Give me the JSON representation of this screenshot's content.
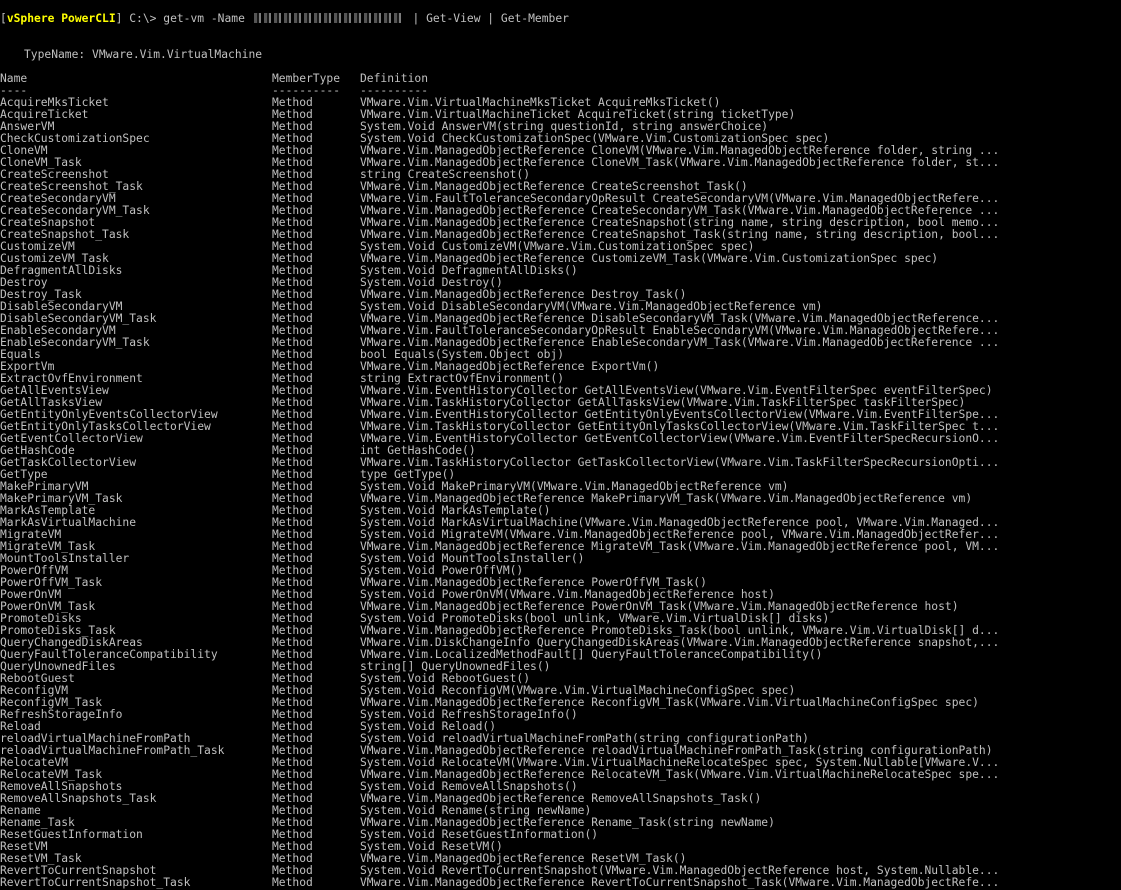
{
  "prompt": {
    "bracket_open": "[",
    "badge": "vSphere PowerCLI",
    "bracket_close": "]",
    "path": " C:\\> ",
    "command_before": "get-vm -Name ",
    "command_after": " | Get-View | Get-Member"
  },
  "typename": "TypeName: VMware.Vim.VirtualMachine",
  "headers": {
    "name": "Name",
    "type": "MemberType",
    "def": "Definition",
    "name_sep": "----",
    "type_sep": "----------",
    "def_sep": "----------"
  },
  "members": [
    {
      "n": "AcquireMksTicket",
      "t": "Method",
      "d": "VMware.Vim.VirtualMachineMksTicket AcquireMksTicket()"
    },
    {
      "n": "AcquireTicket",
      "t": "Method",
      "d": "VMware.Vim.VirtualMachineTicket AcquireTicket(string ticketType)"
    },
    {
      "n": "AnswerVM",
      "t": "Method",
      "d": "System.Void AnswerVM(string questionId, string answerChoice)"
    },
    {
      "n": "CheckCustomizationSpec",
      "t": "Method",
      "d": "System.Void CheckCustomizationSpec(VMware.Vim.CustomizationSpec spec)"
    },
    {
      "n": "CloneVM",
      "t": "Method",
      "d": "VMware.Vim.ManagedObjectReference CloneVM(VMware.Vim.ManagedObjectReference folder, string ..."
    },
    {
      "n": "CloneVM_Task",
      "t": "Method",
      "d": "VMware.Vim.ManagedObjectReference CloneVM_Task(VMware.Vim.ManagedObjectReference folder, st..."
    },
    {
      "n": "CreateScreenshot",
      "t": "Method",
      "d": "string CreateScreenshot()"
    },
    {
      "n": "CreateScreenshot_Task",
      "t": "Method",
      "d": "VMware.Vim.ManagedObjectReference CreateScreenshot_Task()"
    },
    {
      "n": "CreateSecondaryVM",
      "t": "Method",
      "d": "VMware.Vim.FaultToleranceSecondaryOpResult CreateSecondaryVM(VMware.Vim.ManagedObjectRefere..."
    },
    {
      "n": "CreateSecondaryVM_Task",
      "t": "Method",
      "d": "VMware.Vim.ManagedObjectReference CreateSecondaryVM_Task(VMware.Vim.ManagedObjectReference ..."
    },
    {
      "n": "CreateSnapshot",
      "t": "Method",
      "d": "VMware.Vim.ManagedObjectReference CreateSnapshot(string name, string description, bool memo..."
    },
    {
      "n": "CreateSnapshot_Task",
      "t": "Method",
      "d": "VMware.Vim.ManagedObjectReference CreateSnapshot_Task(string name, string description, bool..."
    },
    {
      "n": "CustomizeVM",
      "t": "Method",
      "d": "System.Void CustomizeVM(VMware.Vim.CustomizationSpec spec)"
    },
    {
      "n": "CustomizeVM_Task",
      "t": "Method",
      "d": "VMware.Vim.ManagedObjectReference CustomizeVM_Task(VMware.Vim.CustomizationSpec spec)"
    },
    {
      "n": "DefragmentAllDisks",
      "t": "Method",
      "d": "System.Void DefragmentAllDisks()"
    },
    {
      "n": "Destroy",
      "t": "Method",
      "d": "System.Void Destroy()"
    },
    {
      "n": "Destroy_Task",
      "t": "Method",
      "d": "VMware.Vim.ManagedObjectReference Destroy_Task()"
    },
    {
      "n": "DisableSecondaryVM",
      "t": "Method",
      "d": "System.Void DisableSecondaryVM(VMware.Vim.ManagedObjectReference vm)"
    },
    {
      "n": "DisableSecondaryVM_Task",
      "t": "Method",
      "d": "VMware.Vim.ManagedObjectReference DisableSecondaryVM_Task(VMware.Vim.ManagedObjectReference..."
    },
    {
      "n": "EnableSecondaryVM",
      "t": "Method",
      "d": "VMware.Vim.FaultToleranceSecondaryOpResult EnableSecondaryVM(VMware.Vim.ManagedObjectRefere..."
    },
    {
      "n": "EnableSecondaryVM_Task",
      "t": "Method",
      "d": "VMware.Vim.ManagedObjectReference EnableSecondaryVM_Task(VMware.Vim.ManagedObjectReference ..."
    },
    {
      "n": "Equals",
      "t": "Method",
      "d": "bool Equals(System.Object obj)"
    },
    {
      "n": "ExportVm",
      "t": "Method",
      "d": "VMware.Vim.ManagedObjectReference ExportVm()"
    },
    {
      "n": "ExtractOvfEnvironment",
      "t": "Method",
      "d": "string ExtractOvfEnvironment()"
    },
    {
      "n": "GetAllEventsView",
      "t": "Method",
      "d": "VMware.Vim.EventHistoryCollector GetAllEventsView(VMware.Vim.EventFilterSpec eventFilterSpec)"
    },
    {
      "n": "GetAllTasksView",
      "t": "Method",
      "d": "VMware.Vim.TaskHistoryCollector GetAllTasksView(VMware.Vim.TaskFilterSpec taskFilterSpec)"
    },
    {
      "n": "GetEntityOnlyEventsCollectorView",
      "t": "Method",
      "d": "VMware.Vim.EventHistoryCollector GetEntityOnlyEventsCollectorView(VMware.Vim.EventFilterSpe..."
    },
    {
      "n": "GetEntityOnlyTasksCollectorView",
      "t": "Method",
      "d": "VMware.Vim.TaskHistoryCollector GetEntityOnlyTasksCollectorView(VMware.Vim.TaskFilterSpec t..."
    },
    {
      "n": "GetEventCollectorView",
      "t": "Method",
      "d": "VMware.Vim.EventHistoryCollector GetEventCollectorView(VMware.Vim.EventFilterSpecRecursionO..."
    },
    {
      "n": "GetHashCode",
      "t": "Method",
      "d": "int GetHashCode()"
    },
    {
      "n": "GetTaskCollectorView",
      "t": "Method",
      "d": "VMware.Vim.TaskHistoryCollector GetTaskCollectorView(VMware.Vim.TaskFilterSpecRecursionOpti..."
    },
    {
      "n": "GetType",
      "t": "Method",
      "d": "type GetType()"
    },
    {
      "n": "MakePrimaryVM",
      "t": "Method",
      "d": "System.Void MakePrimaryVM(VMware.Vim.ManagedObjectReference vm)"
    },
    {
      "n": "MakePrimaryVM_Task",
      "t": "Method",
      "d": "VMware.Vim.ManagedObjectReference MakePrimaryVM_Task(VMware.Vim.ManagedObjectReference vm)"
    },
    {
      "n": "MarkAsTemplate",
      "t": "Method",
      "d": "System.Void MarkAsTemplate()"
    },
    {
      "n": "MarkAsVirtualMachine",
      "t": "Method",
      "d": "System.Void MarkAsVirtualMachine(VMware.Vim.ManagedObjectReference pool, VMware.Vim.Managed..."
    },
    {
      "n": "MigrateVM",
      "t": "Method",
      "d": "System.Void MigrateVM(VMware.Vim.ManagedObjectReference pool, VMware.Vim.ManagedObjectRefer..."
    },
    {
      "n": "MigrateVM_Task",
      "t": "Method",
      "d": "VMware.Vim.ManagedObjectReference MigrateVM_Task(VMware.Vim.ManagedObjectReference pool, VM..."
    },
    {
      "n": "MountToolsInstaller",
      "t": "Method",
      "d": "System.Void MountToolsInstaller()"
    },
    {
      "n": "PowerOffVM",
      "t": "Method",
      "d": "System.Void PowerOffVM()"
    },
    {
      "n": "PowerOffVM_Task",
      "t": "Method",
      "d": "VMware.Vim.ManagedObjectReference PowerOffVM_Task()"
    },
    {
      "n": "PowerOnVM",
      "t": "Method",
      "d": "System.Void PowerOnVM(VMware.Vim.ManagedObjectReference host)"
    },
    {
      "n": "PowerOnVM_Task",
      "t": "Method",
      "d": "VMware.Vim.ManagedObjectReference PowerOnVM_Task(VMware.Vim.ManagedObjectReference host)"
    },
    {
      "n": "PromoteDisks",
      "t": "Method",
      "d": "System.Void PromoteDisks(bool unlink, VMware.Vim.VirtualDisk[] disks)"
    },
    {
      "n": "PromoteDisks_Task",
      "t": "Method",
      "d": "VMware.Vim.ManagedObjectReference PromoteDisks_Task(bool unlink, VMware.Vim.VirtualDisk[] d..."
    },
    {
      "n": "QueryChangedDiskAreas",
      "t": "Method",
      "d": "VMware.Vim.DiskChangeInfo QueryChangedDiskAreas(VMware.Vim.ManagedObjectReference snapshot,..."
    },
    {
      "n": "QueryFaultToleranceCompatibility",
      "t": "Method",
      "d": "VMware.Vim.LocalizedMethodFault[] QueryFaultToleranceCompatibility()"
    },
    {
      "n": "QueryUnownedFiles",
      "t": "Method",
      "d": "string[] QueryUnownedFiles()"
    },
    {
      "n": "RebootGuest",
      "t": "Method",
      "d": "System.Void RebootGuest()"
    },
    {
      "n": "ReconfigVM",
      "t": "Method",
      "d": "System.Void ReconfigVM(VMware.Vim.VirtualMachineConfigSpec spec)"
    },
    {
      "n": "ReconfigVM_Task",
      "t": "Method",
      "d": "VMware.Vim.ManagedObjectReference ReconfigVM_Task(VMware.Vim.VirtualMachineConfigSpec spec)"
    },
    {
      "n": "RefreshStorageInfo",
      "t": "Method",
      "d": "System.Void RefreshStorageInfo()"
    },
    {
      "n": "Reload",
      "t": "Method",
      "d": "System.Void Reload()"
    },
    {
      "n": "reloadVirtualMachineFromPath",
      "t": "Method",
      "d": "System.Void reloadVirtualMachineFromPath(string configurationPath)"
    },
    {
      "n": "reloadVirtualMachineFromPath_Task",
      "t": "Method",
      "d": "VMware.Vim.ManagedObjectReference reloadVirtualMachineFromPath_Task(string configurationPath)"
    },
    {
      "n": "RelocateVM",
      "t": "Method",
      "d": "System.Void RelocateVM(VMware.Vim.VirtualMachineRelocateSpec spec, System.Nullable[VMware.V..."
    },
    {
      "n": "RelocateVM_Task",
      "t": "Method",
      "d": "VMware.Vim.ManagedObjectReference RelocateVM_Task(VMware.Vim.VirtualMachineRelocateSpec spe..."
    },
    {
      "n": "RemoveAllSnapshots",
      "t": "Method",
      "d": "System.Void RemoveAllSnapshots()"
    },
    {
      "n": "RemoveAllSnapshots_Task",
      "t": "Method",
      "d": "VMware.Vim.ManagedObjectReference RemoveAllSnapshots_Task()"
    },
    {
      "n": "Rename",
      "t": "Method",
      "d": "System.Void Rename(string newName)"
    },
    {
      "n": "Rename_Task",
      "t": "Method",
      "d": "VMware.Vim.ManagedObjectReference Rename_Task(string newName)"
    },
    {
      "n": "ResetGuestInformation",
      "t": "Method",
      "d": "System.Void ResetGuestInformation()"
    },
    {
      "n": "ResetVM",
      "t": "Method",
      "d": "System.Void ResetVM()"
    },
    {
      "n": "ResetVM_Task",
      "t": "Method",
      "d": "VMware.Vim.ManagedObjectReference ResetVM_Task()"
    },
    {
      "n": "RevertToCurrentSnapshot",
      "t": "Method",
      "d": "System.Void RevertToCurrentSnapshot(VMware.Vim.ManagedObjectReference host, System.Nullable..."
    },
    {
      "n": "RevertToCurrentSnapshot_Task",
      "t": "Method",
      "d": "VMware.Vim.ManagedObjectReference RevertToCurrentSnapshot_Task(VMware.Vim.ManagedObjectRefe..."
    }
  ]
}
